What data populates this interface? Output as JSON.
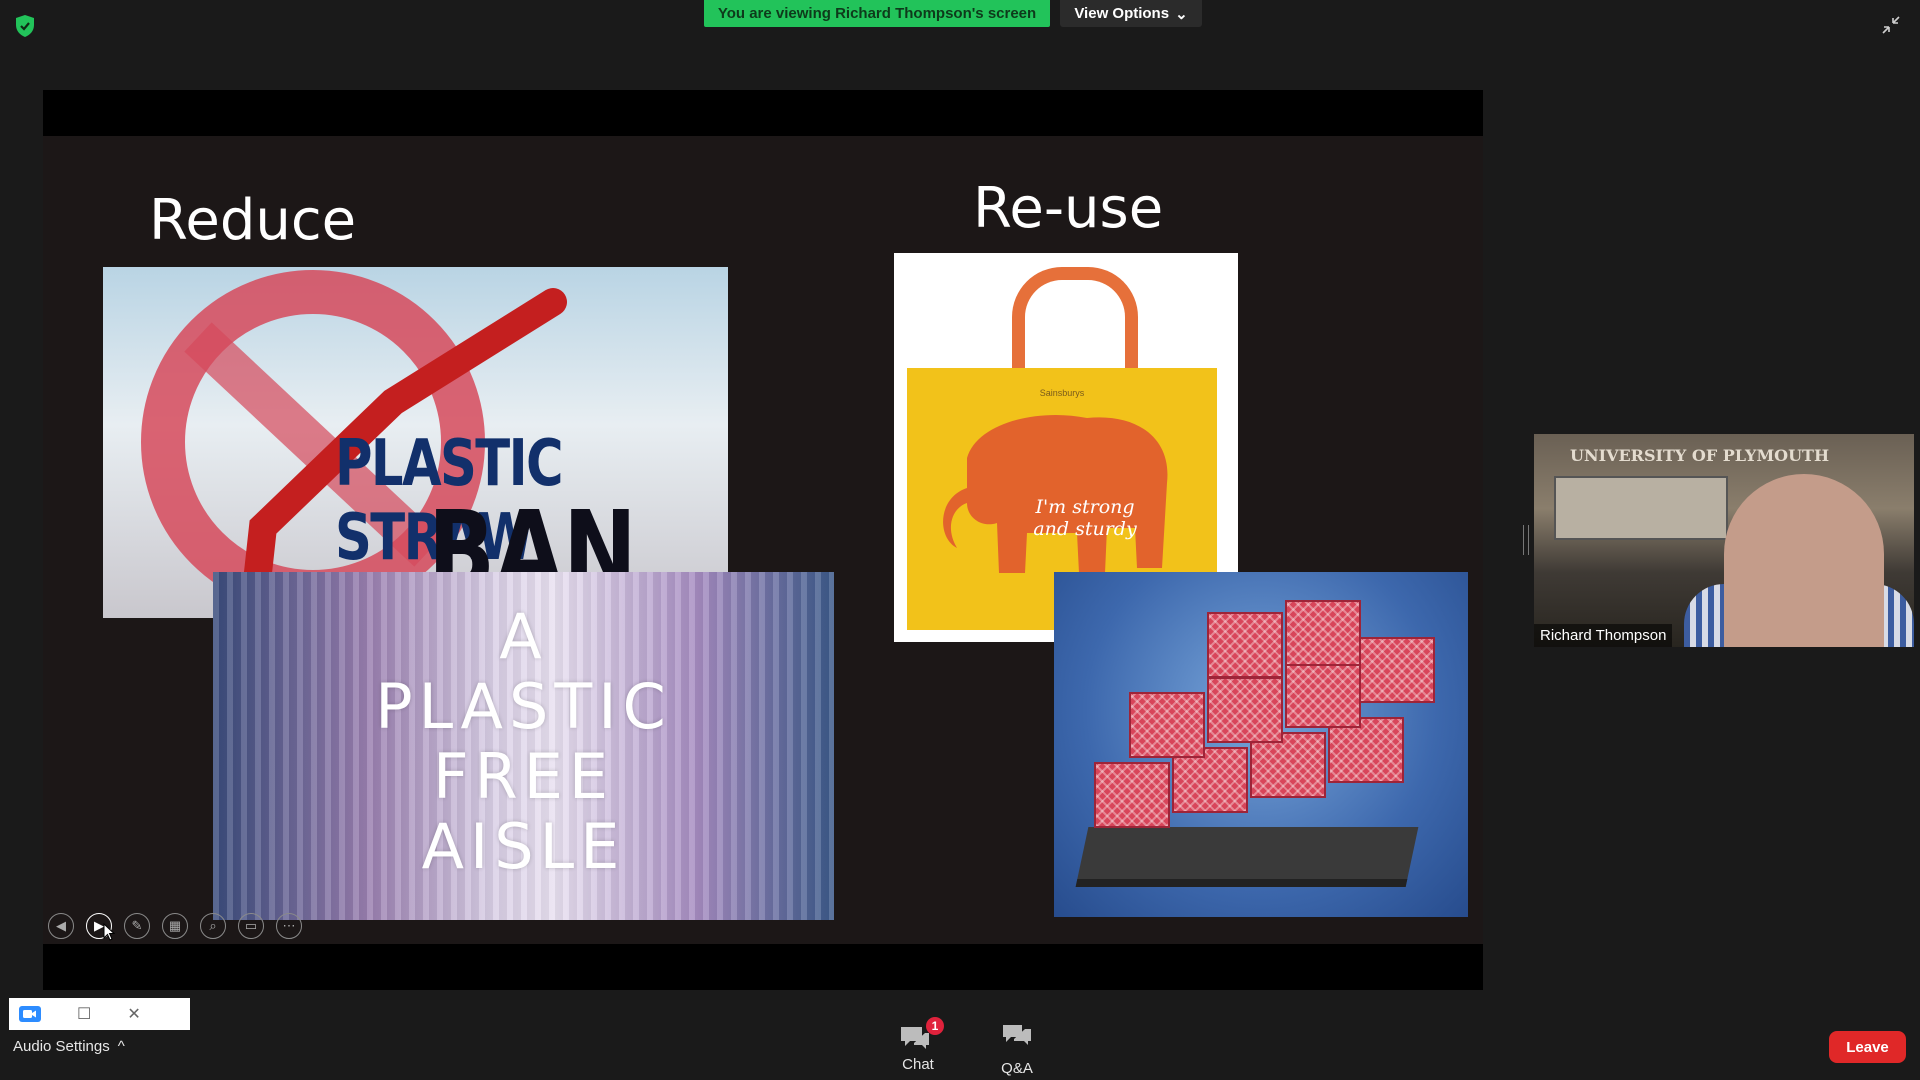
{
  "top_bar": {
    "viewing_banner": "You are viewing Richard Thompson's screen",
    "view_options_label": "View Options",
    "view_options_chevron": "⌄"
  },
  "slide": {
    "left_title": "Reduce",
    "right_title": "Re-use",
    "straw_line1": "PLASTIC STRAW",
    "straw_line2": "BAN",
    "aisle_lines": [
      "A",
      "PLASTIC",
      "FREE",
      "AISLE"
    ],
    "bag_brand": "Sainsburys",
    "bag_slogan": "I'm strong and sturdy"
  },
  "slide_controls": [
    {
      "name": "previous-slide-button",
      "glyph": "◀"
    },
    {
      "name": "next-slide-button",
      "glyph": "▶"
    },
    {
      "name": "pen-tool-button",
      "glyph": "✎"
    },
    {
      "name": "all-slides-button",
      "glyph": "▦"
    },
    {
      "name": "zoom-button",
      "glyph": "⌕"
    },
    {
      "name": "subtitles-button",
      "glyph": "▭"
    },
    {
      "name": "more-options-button",
      "glyph": "⋯"
    }
  ],
  "participant": {
    "name": "Richard Thompson",
    "background_logo": "UNIVERSITY OF PLYMOUTH"
  },
  "mini_window": {
    "restore_glyph": "☐",
    "close_glyph": "✕"
  },
  "audio": {
    "label": "Audio Settings",
    "chevron": "^"
  },
  "toolbar": {
    "chat_label": "Chat",
    "chat_badge": "1",
    "qa_label": "Q&A",
    "leave_label": "Leave"
  },
  "colors": {
    "banner_green": "#22c35a",
    "leave_red": "#e02828",
    "badge_red": "#e0223c",
    "zoom_blue": "#2d8cff"
  }
}
